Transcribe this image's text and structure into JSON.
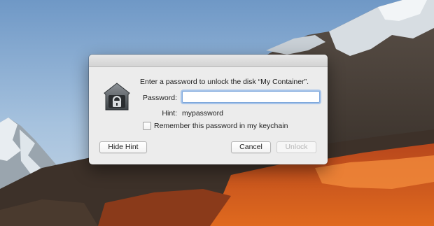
{
  "dialog": {
    "prompt": "Enter a password to unlock the disk “My Container”.",
    "password_label": "Password:",
    "password_value": "",
    "hint_label": "Hint:",
    "hint_value": "mypassword",
    "remember_label": "Remember this password in my keychain",
    "remember_checked": false,
    "hide_hint_label": "Hide Hint",
    "cancel_label": "Cancel",
    "unlock_label": "Unlock",
    "unlock_enabled": false,
    "icon": "lock-icon"
  }
}
